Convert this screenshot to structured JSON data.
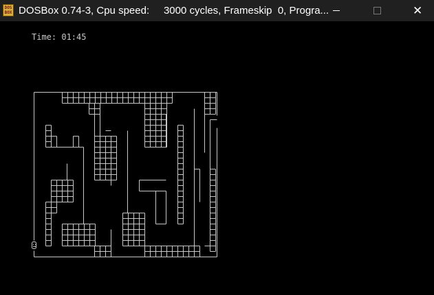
{
  "window": {
    "title": "DOSBox 0.74-3, Cpu speed:     3000 cycles, Frameskip  0, Progra...",
    "icon_lines": [
      "DOS",
      "BOX"
    ],
    "icon_name": "dosbox-app-icon",
    "minimize_icon": "minimize-icon",
    "maximize_icon": "maximize-icon",
    "close_icon": "close-icon",
    "close_glyph": "✕"
  },
  "game": {
    "time_text": "Time: 01:45",
    "player_icon": "player-face-icon",
    "colors": {
      "background": "#000000",
      "walls": "#c8c8c8",
      "titlebar": "#202020"
    }
  }
}
